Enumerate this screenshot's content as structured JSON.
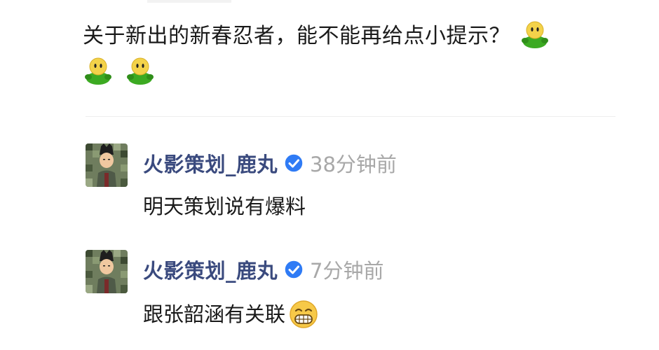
{
  "post": {
    "text": "关于新出的新春忍者，能不能再给点小提示？",
    "trailing_emoji": [
      "green-figure-emoji",
      "green-figure-emoji",
      "green-figure-emoji"
    ]
  },
  "comments": [
    {
      "username": "火影策划_鹿丸",
      "verified": true,
      "timestamp": "38分钟前",
      "text": "明天策划说有爆料",
      "emoji": ""
    },
    {
      "username": "火影策划_鹿丸",
      "verified": true,
      "timestamp": "7分钟前",
      "text": "跟张韶涵有关联",
      "emoji": "grinning-face-emoji"
    }
  ],
  "colors": {
    "username": "#3a4a7e",
    "timestamp": "#a8a8a8",
    "verified_badge": "#2f7bf5",
    "emoji_green": "#3caa22",
    "emoji_yellow": "#f3d24a"
  }
}
